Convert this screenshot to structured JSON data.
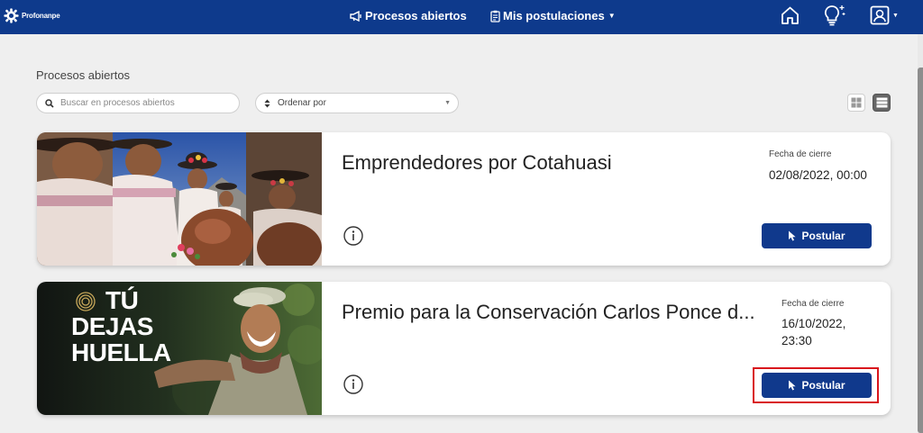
{
  "navbar": {
    "logo_text": "Profonanpe",
    "links": [
      {
        "label": "Procesos abiertos",
        "icon": "megaphone-icon"
      },
      {
        "label": "Mis postulaciones",
        "icon": "clipboard-icon"
      }
    ],
    "icons": [
      "home-icon",
      "lightbulb-icon",
      "user-icon"
    ]
  },
  "page": {
    "title": "Procesos abiertos",
    "search_placeholder": "Buscar en procesos abiertos",
    "sort_label": "Ordenar por"
  },
  "cards": [
    {
      "title": "Emprendedores por Cotahuasi",
      "close_label": "Fecha de cierre",
      "close_date": "02/08/2022, 00:00",
      "button_label": "Postular",
      "image": "women-in-traditional-hats-photo"
    },
    {
      "title": "Premio para la Conservación Carlos Ponce d...",
      "close_label": "Fecha de cierre",
      "close_date": "16/10/2022, 23:30",
      "button_label": "Postular",
      "image": "tu-dejas-huella-poster",
      "poster_text": [
        "TÚ",
        "DEJAS",
        "HUELLA"
      ]
    }
  ],
  "colors": {
    "navbar": "#0e3a8c",
    "button": "#10398c",
    "highlight": "#d9161c",
    "background": "#efefef"
  }
}
